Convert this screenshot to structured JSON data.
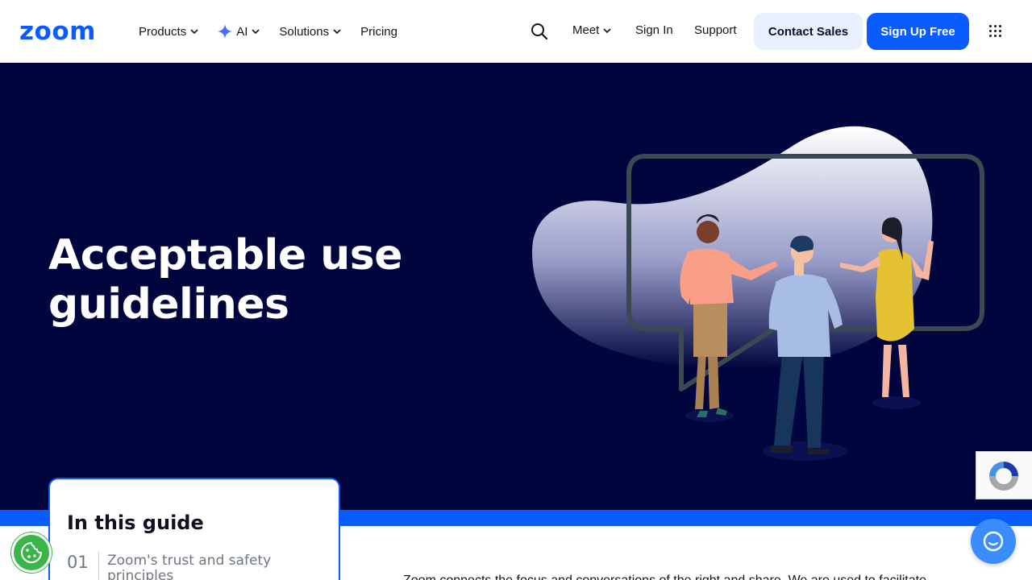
{
  "header": {
    "logo_text": "zoom",
    "nav": {
      "products": "Products",
      "ai": "AI",
      "solutions": "Solutions",
      "pricing": "Pricing"
    },
    "meet": "Meet",
    "sign_in": "Sign In",
    "support": "Support",
    "contact_sales": "Contact Sales",
    "sign_up_free": "Sign Up Free",
    "icons": {
      "search": "search-icon",
      "ai_sparkle": "sparkle-icon",
      "apps": "apps-grid-icon"
    }
  },
  "hero": {
    "title_line1": "Acceptable use",
    "title_line2": "guidelines"
  },
  "guide": {
    "title": "In this guide",
    "items": [
      {
        "number": "01",
        "label": "Zoom's trust and safety principles"
      }
    ]
  },
  "body": {
    "intro_partial": "Zoom connects the focus and conversations of the right and share. We are used to facilitate"
  },
  "colors": {
    "brand_blue": "#0b5cff",
    "hero_bg": "#00053d",
    "cookie_green": "#39b54a"
  }
}
